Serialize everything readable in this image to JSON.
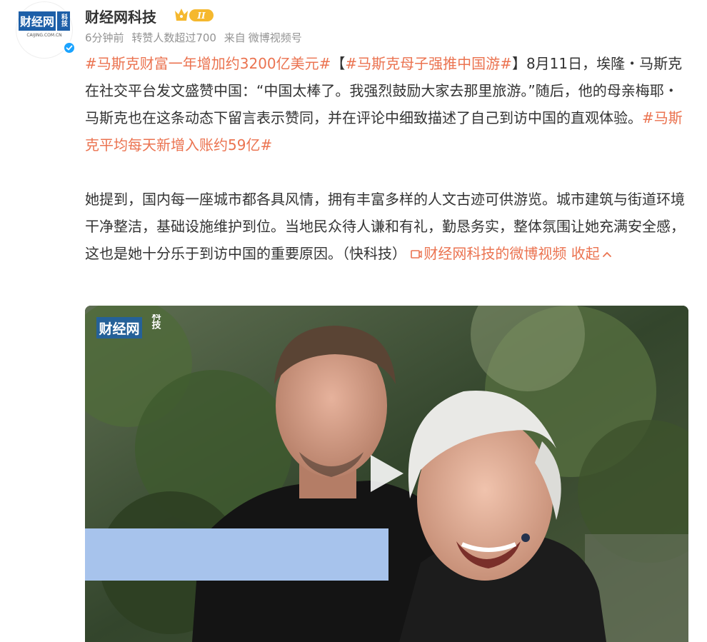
{
  "author": {
    "name": "财经网科技",
    "avatar_logo_text": "财经网",
    "avatar_logo_side": "科技",
    "avatar_logo_domain": "CAIJING.COM.CN",
    "vip_level": "II",
    "verified": true
  },
  "meta": {
    "time": "6分钟前",
    "reposts": "转赞人数超过700",
    "source_prefix": "来自",
    "source": "微博视频号"
  },
  "content": {
    "topic1": "#马斯克财富一年增加约3200亿美元#",
    "bracket_open": "【",
    "topic2": "#马斯克母子强推中国游#",
    "bracket_close": "】",
    "para1_text": "8月11日，埃隆・马斯克在社交平台发文盛赞中国：“中国太棒了。我强烈鼓励大家去那里旅游。”随后，他的母亲梅耶・马斯克也在这条动态下留言表示赞同，并在评论中细致描述了自己到访中国的直观体验。",
    "topic3": "#马斯克平均每天新增入账约59亿#",
    "para2_text": "她提到，国内每一座城市都各具风情，拥有丰富多样的人文古迹可供游览。城市建筑与街道环境干净整洁，基础设施维护到位。当地民众待人谦和有礼，勤恳务实，整体氛围让她充满安全感，这也是她十分乐于到访中国的重要原因。（快科技）",
    "video_link": "财经网科技的微博视频",
    "collapse": "收起"
  },
  "video": {
    "watermark_main": "财经网",
    "watermark_side": "科技"
  },
  "colors": {
    "accent": "#eb7350",
    "meta_gray": "#939393",
    "text": "#333333",
    "verified_blue": "#1aa3ff",
    "vip_gold": "#f5b82e",
    "caption_box": "#a7c3ec"
  }
}
